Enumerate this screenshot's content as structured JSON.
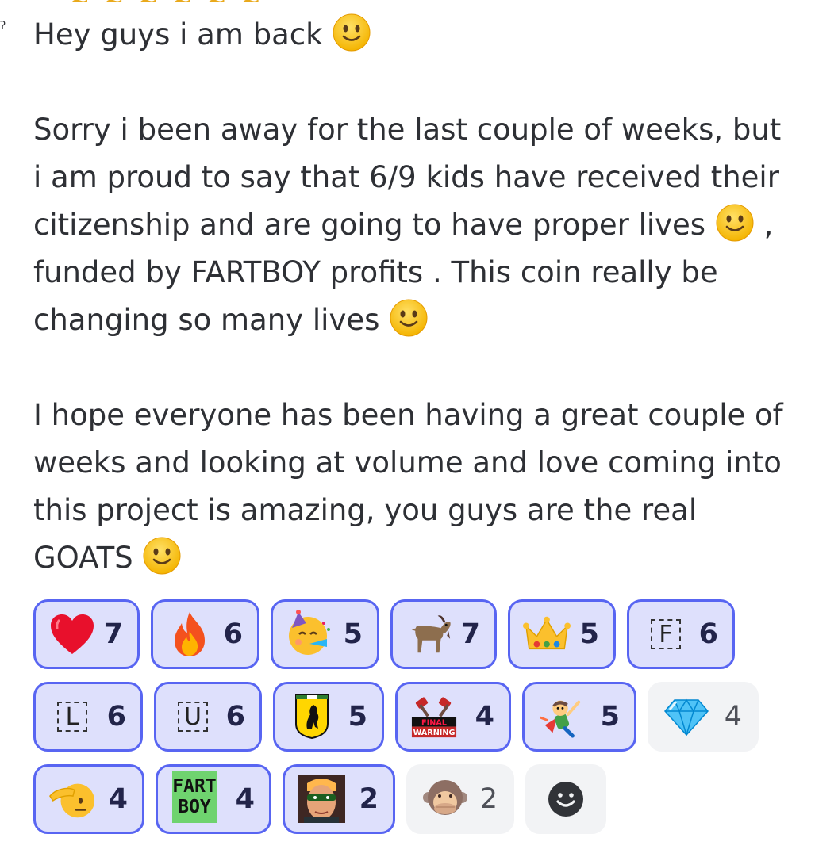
{
  "message": {
    "line1": "Hey guys i am back",
    "para2_lines": [
      "Sorry i been away for the last couple of weeks, but",
      "i am proud to say that 6/9 kids have received their",
      "citizenship and are going to have proper lives",
      "funded by FARTBOY profits . This coin really be",
      "changing so many lives"
    ],
    "para2_line3_suffix": " ,",
    "para3_lines": [
      "I hope everyone has been having a great couple of",
      "weeks and looking at volume and love coming into",
      "this project is amazing, you guys are the real",
      "GOATS"
    ],
    "smile_icon": "slightly-smiling-face-icon"
  },
  "reactions": {
    "row1": [
      {
        "icon": "red-heart-icon",
        "count": "7"
      },
      {
        "icon": "fire-icon",
        "count": "6"
      },
      {
        "icon": "partying-face-icon",
        "count": "5"
      },
      {
        "icon": "goat-icon",
        "count": "7"
      },
      {
        "icon": "crown-icon",
        "count": "5"
      },
      {
        "icon": "letter-f-icon",
        "letter": "F",
        "count": "6"
      }
    ],
    "row2": [
      {
        "icon": "letter-l-icon",
        "letter": "L",
        "count": "6"
      },
      {
        "icon": "letter-u-icon",
        "letter": "U",
        "count": "6"
      },
      {
        "icon": "ferrari-icon",
        "count": "5"
      },
      {
        "icon": "final-warning-icon",
        "text": "FINAL WARNING",
        "count": "4"
      },
      {
        "icon": "superhero-kid-icon",
        "count": "5"
      },
      {
        "icon": "gem-icon",
        "count": "4"
      }
    ],
    "row3": [
      {
        "icon": "saluting-face-icon",
        "count": "4"
      },
      {
        "icon": "fart-boy-icon",
        "text_top": "FART",
        "text_bottom": "BOY",
        "count": "4"
      },
      {
        "icon": "masked-man-icon",
        "count": "2"
      },
      {
        "icon": "speak-no-evil-monkey-icon",
        "count": "2"
      }
    ],
    "add_reaction_icon": "add-reaction-icon"
  },
  "colors": {
    "selected_bg": "#dee0fc",
    "selected_border": "#5865f2",
    "unselected_bg": "#f2f3f5"
  }
}
